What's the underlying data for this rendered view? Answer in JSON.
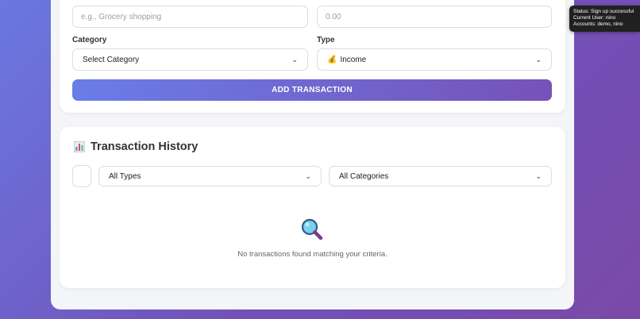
{
  "form": {
    "description_placeholder": "e.g., Grocery shopping",
    "amount_placeholder": "0.00",
    "category_label": "Category",
    "category_selected": "Select Category",
    "type_label": "Type",
    "type_selected_icon": "💰",
    "type_selected": "Income",
    "add_button": "ADD TRANSACTION"
  },
  "history": {
    "icon": "bar-chart-icon",
    "title": "Transaction History",
    "type_filter_selected": "All Types",
    "category_filter_selected": "All Categories",
    "empty_icon": "magnifier-icon",
    "empty_message": "No transactions found matching your criteria."
  },
  "status": {
    "line1": "Status: Sign up successful",
    "line2": "Current User: nino",
    "line3": "Accounts: demo, nino"
  },
  "colors": {
    "accent_start": "#6a7de8",
    "accent_end": "#7652b8",
    "background_start": "#6a78e0",
    "background_end": "#7a4aa8"
  }
}
